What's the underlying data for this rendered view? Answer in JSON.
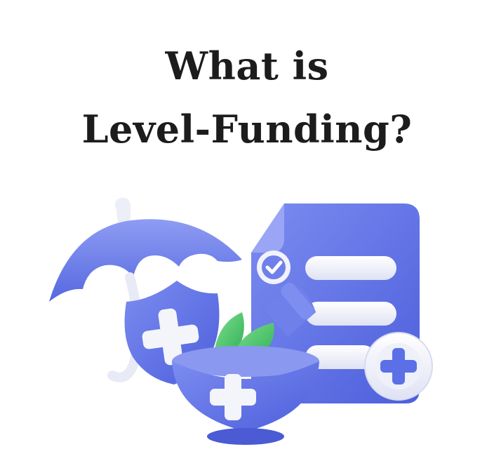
{
  "heading": {
    "line1": "What is",
    "line2": "Level-Funding?"
  },
  "icons": [
    "umbrella-icon",
    "shield-plus-icon",
    "document-checklist-icon",
    "check-icon",
    "plus-badge-icon",
    "mortar-bowl-icon",
    "leaves-icon",
    "bottle-icon"
  ],
  "colors": {
    "text": "#1c1c1c",
    "accent_blue": "#5b6fe6",
    "light_blue": "#8b99f2",
    "white": "#f4f5fb",
    "leaf_green": "#4cc36a"
  }
}
